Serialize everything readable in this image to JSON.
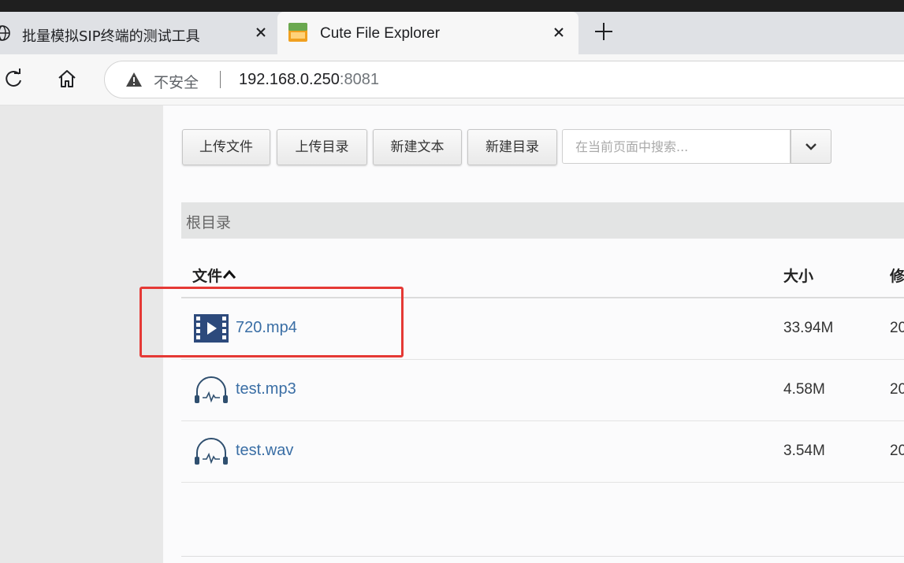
{
  "browser": {
    "tabs": [
      {
        "title": "批量模拟SIP终端的测试工具",
        "icon": "globe-icon",
        "active": false
      },
      {
        "title": "Cute File Explorer",
        "icon": "cute-file-explorer-favicon",
        "active": true
      }
    ],
    "address_bar": {
      "security_label": "不安全",
      "host": "192.168.0.250",
      "port": ":8081"
    }
  },
  "toolbar": {
    "upload_file": "上传文件",
    "upload_dir": "上传目录",
    "new_text": "新建文本",
    "new_dir": "新建目录",
    "search_placeholder": "在当前页面中搜索..."
  },
  "breadcrumb": "根目录",
  "table": {
    "headers": {
      "name": "文件",
      "size": "大小",
      "modified": "修"
    },
    "rows": [
      {
        "name": "720.mp4",
        "icon": "video-file-icon",
        "size": "33.94M",
        "date": "20"
      },
      {
        "name": "test.mp3",
        "icon": "audio-file-icon",
        "size": "4.58M",
        "date": "20"
      },
      {
        "name": "test.wav",
        "icon": "audio-file-icon",
        "size": "3.54M",
        "date": "20"
      }
    ]
  },
  "colors": {
    "link": "#3a6ea5",
    "highlight": "#e53935",
    "video_icon": "#2d4a7c",
    "audio_icon": "#2f4f6f"
  }
}
